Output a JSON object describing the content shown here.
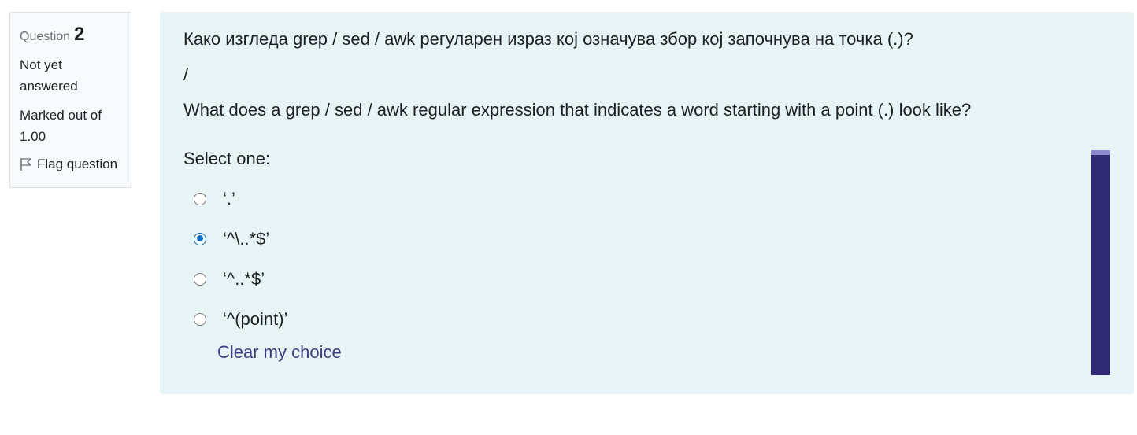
{
  "info": {
    "question_label": "Question",
    "question_number": "2",
    "state_line1": "Not yet",
    "state_line2": "answered",
    "grade_line1": "Marked out of",
    "grade_line2": "1.00",
    "flag_label": "Flag question"
  },
  "question": {
    "text_mk": "Како изгледа grep / sed / awk регуларен израз кој означува збор кој започнува на точка (.)?",
    "separator": "/",
    "text_en": "What does a grep / sed / awk regular expression that indicates a word starting with a point (.) look like?",
    "prompt": "Select one:",
    "options": [
      {
        "label": "‘.’",
        "selected": false
      },
      {
        "label": "‘^\\..*$’",
        "selected": true
      },
      {
        "label": "‘^..*$’",
        "selected": false
      },
      {
        "label": "‘^(point)’",
        "selected": false
      }
    ],
    "clear_label": "Clear my choice"
  },
  "colors": {
    "panel_bg": "#e7f3f5",
    "link": "#3c3f83",
    "radio_selected": "#0f6cbf",
    "scrollbar": "#312b75"
  }
}
